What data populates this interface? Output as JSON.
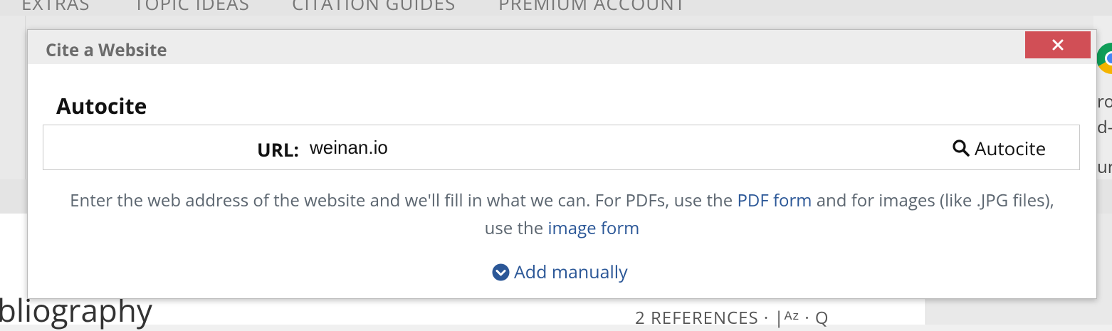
{
  "background": {
    "nav_items": [
      "EXTRAS",
      "TOPIC IDEAS",
      "CITATION GUIDES",
      "PREMIUM ACCOUNT"
    ],
    "heading_partial": "bliography",
    "references_label": "2 REFERENCES",
    "side_texts": [
      "ro",
      "d-",
      "ur"
    ]
  },
  "modal": {
    "title": "Cite a Website",
    "close_label": "✕",
    "section_heading": "Autocite",
    "url_label": "URL:",
    "url_value": "weinan.io",
    "autocite_label": "Autocite",
    "help_part1": "Enter the web address of the website and we'll fill in what we can. For PDFs, use the ",
    "pdf_link": "PDF form",
    "help_part2": " and for images (like .JPG files), use the ",
    "image_link": "image form",
    "add_manually_label": "Add manually"
  },
  "colors": {
    "close_button": "#d14f56",
    "link": "#2b5797",
    "header_bg": "#ededed"
  }
}
